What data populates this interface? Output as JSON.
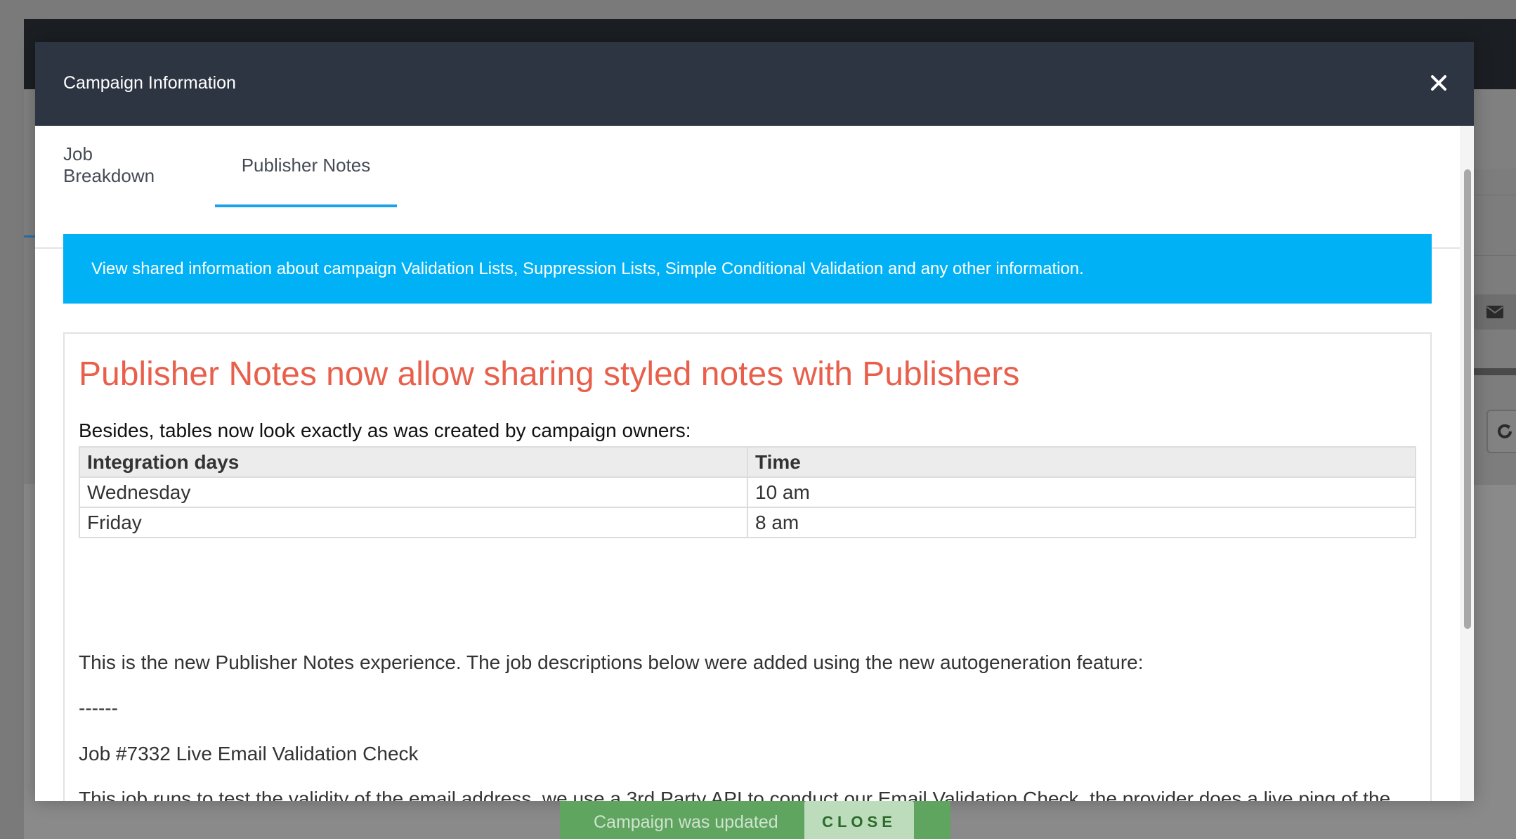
{
  "modal": {
    "title": "Campaign Information",
    "close_icon": "close-icon"
  },
  "tabs": [
    {
      "label": "Job Breakdown",
      "active": false
    },
    {
      "label": "Publisher Notes",
      "active": true
    }
  ],
  "info_banner": {
    "text": "View shared information about campaign Validation Lists, Suppression Lists, Simple Conditional Validation and any other information.",
    "color": "#00b2f5"
  },
  "notes": {
    "heading": "Publisher Notes now allow sharing styled notes with Publishers",
    "heading_color": "#e8604c",
    "subheading": "Besides, tables now look exactly as was created by campaign owners:",
    "table": {
      "headers": [
        "Integration days",
        "Time"
      ],
      "rows": [
        [
          "Wednesday",
          "10 am"
        ],
        [
          "Friday",
          "8 am"
        ]
      ]
    },
    "paragraphs": [
      "This is the new Publisher Notes experience. The job descriptions below were added using the new autogeneration feature:",
      "------",
      "Job #7332 Live Email Validation Check",
      "This job runs to test the validity of the email address, we use a 3rd Party API to conduct our Email Validation Check, the provider does a live ping of the email address to ensure that it is real."
    ]
  },
  "toast": {
    "message": "Campaign was updated",
    "action_label": "CLOSE",
    "color": "#5fa45f"
  },
  "background": {
    "mail_icon": "envelope-icon",
    "refresh_icon": "refresh-icon"
  }
}
